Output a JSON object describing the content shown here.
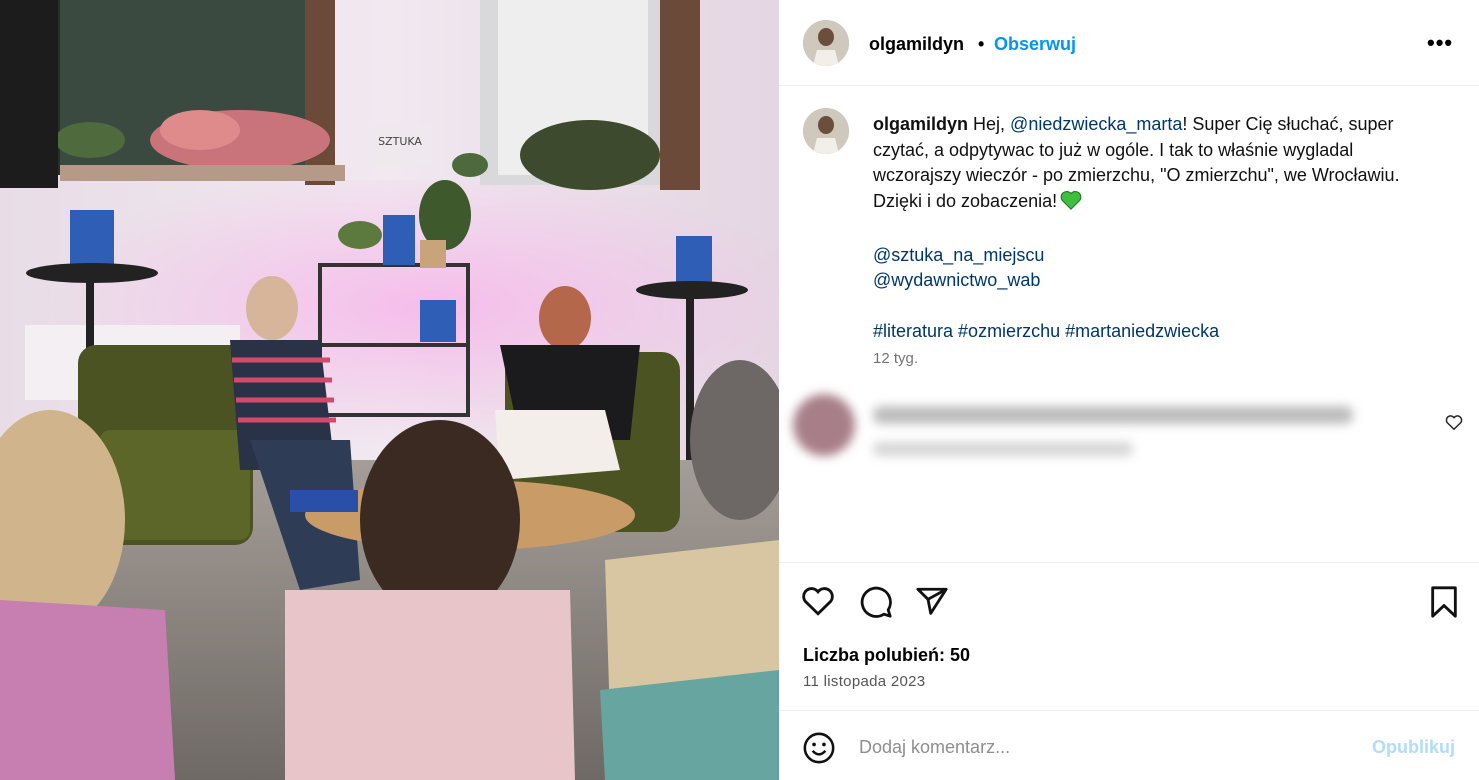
{
  "post": {
    "photo_alt": "",
    "sign_text": "SZTUKA"
  },
  "header": {
    "username": "olgamildyn",
    "separator": "•",
    "follow_label": "Obserwuj",
    "more_label": "•••"
  },
  "caption": {
    "username": "olgamildyn",
    "lines": [
      {
        "before": "Hej, ",
        "mention": "@niedzwiecka_marta",
        "after": "! Super Cię słuchać, super"
      },
      {
        "text": "czytać, a odpytywac to już w ogóle. I tak to właśnie wygladal"
      },
      {
        "text": "wczorajszy wieczór - po zmierzchu, \"O zmierzchu\", we Wrocławiu."
      },
      {
        "text": "Dzięki i do zobaczenia!"
      }
    ],
    "mentions": [
      "@sztuka_na_miejscu",
      "@wydawnictwo_wab"
    ],
    "hashtags": "#literatura #ozmierzchu #martaniedzwiecka",
    "time": "12 tyg."
  },
  "stats": {
    "likes": "Liczba polubień: 50",
    "date": "11 listopada 2023"
  },
  "composer": {
    "placeholder": "Dodaj komentarz...",
    "publish_label": "Opublikuj"
  },
  "colors": {
    "follow": "#0095f6",
    "mention": "#00376b",
    "publish_disabled": "#b3dbff",
    "heart_emoji": "#3fbf3f"
  },
  "icons": [
    "like-icon",
    "comment-icon",
    "share-icon",
    "bookmark-icon",
    "emoji-icon",
    "more-icon",
    "comment-like-icon",
    "green-heart-icon"
  ]
}
